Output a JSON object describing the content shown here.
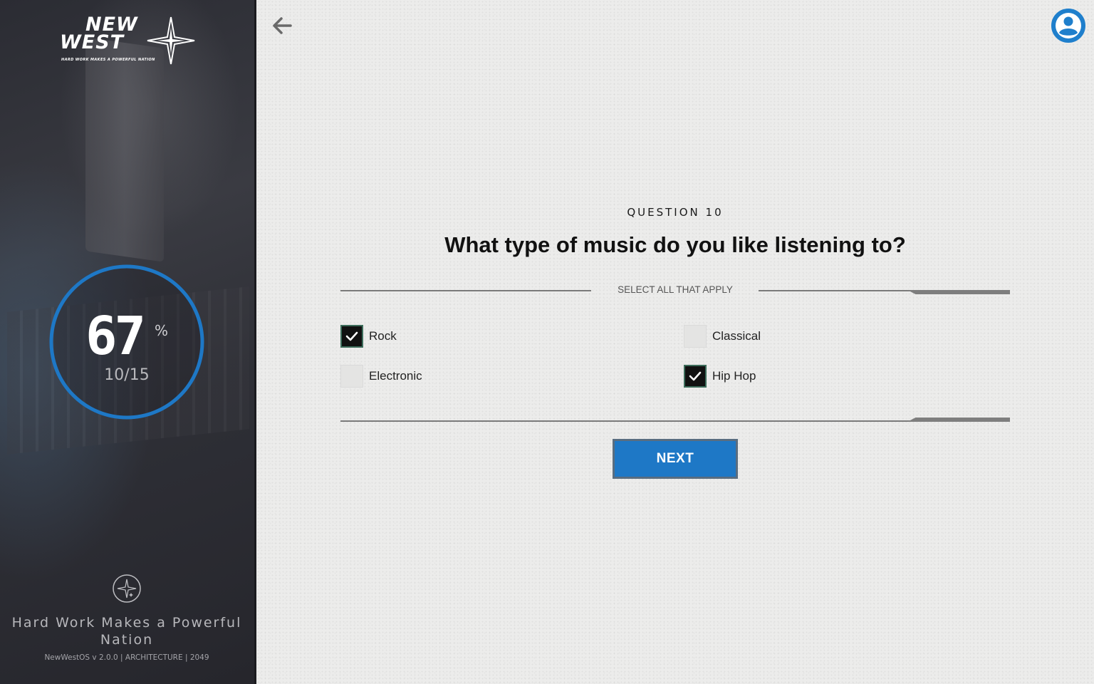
{
  "sidebar": {
    "logo_line1": "NEW",
    "logo_line2": "WEST",
    "logo_tagline": "HARD WORK MAKES A POWERFUL NATION",
    "progress_percent": "67",
    "progress_fraction": 0.67,
    "percent_sign": "%",
    "progress_count": "10/15",
    "motto": "Hard Work Makes a Powerful Nation",
    "version_info": "NewWestOS v 2.0.0  | ARCHITECTURE | 2049",
    "ring_color": "#1e78c6"
  },
  "header": {
    "back_icon": "arrow-left-icon",
    "avatar_icon": "user-avatar-icon"
  },
  "question": {
    "label": "QUESTION 10",
    "title": "What type of music do you like listening to?",
    "instruction": "SELECT ALL THAT APPLY",
    "options": [
      {
        "label": "Rock",
        "checked": true
      },
      {
        "label": "Classical",
        "checked": false
      },
      {
        "label": "Electronic",
        "checked": false
      },
      {
        "label": "Hip Hop",
        "checked": true
      }
    ]
  },
  "actions": {
    "next_label": "NEXT"
  },
  "colors": {
    "accent": "#1e78c6",
    "background": "#ececeb",
    "sidebar": "#2e2f36"
  }
}
